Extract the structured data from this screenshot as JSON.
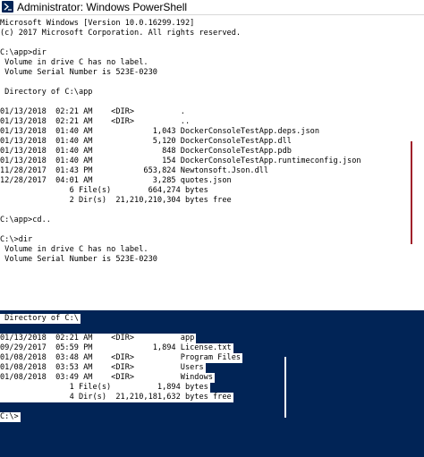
{
  "window": {
    "title": "Administrator: Windows PowerShell",
    "icon": "powershell-icon"
  },
  "console": {
    "upper_lines": [
      "Microsoft Windows [Version 10.0.16299.192]",
      "(c) 2017 Microsoft Corporation. All rights reserved.",
      "",
      "C:\\app>dir",
      " Volume in drive C has no label.",
      " Volume Serial Number is 523E-0230",
      "",
      " Directory of C:\\app",
      "",
      "01/13/2018  02:21 AM    <DIR>          .",
      "01/13/2018  02:21 AM    <DIR>          ..",
      "01/13/2018  01:40 AM             1,043 DockerConsoleTestApp.deps.json",
      "01/13/2018  01:40 AM             5,120 DockerConsoleTestApp.dll",
      "01/13/2018  01:40 AM               848 DockerConsoleTestApp.pdb",
      "01/13/2018  01:40 AM               154 DockerConsoleTestApp.runtimeconfig.json",
      "11/28/2017  01:43 PM           653,824 Newtonsoft.Json.dll",
      "12/28/2017  04:01 AM             3,285 quotes.json",
      "               6 File(s)        664,274 bytes",
      "               2 Dir(s)  21,210,210,304 bytes free",
      "",
      "C:\\app>cd..",
      "",
      "C:\\>dir",
      " Volume in drive C has no label.",
      " Volume Serial Number is 523E-0230",
      ""
    ],
    "lower_lines": [
      " Directory of C:\\",
      "",
      "01/13/2018  02:21 AM    <DIR>          app",
      "09/29/2017  05:59 PM             1,894 License.txt",
      "01/08/2018  03:48 AM    <DIR>          Program Files",
      "01/08/2018  03:53 AM    <DIR>          Users",
      "01/08/2018  03:49 AM    <DIR>          Windows",
      "               1 File(s)          1,894 bytes",
      "               4 Dir(s)  21,210,181,632 bytes free",
      "",
      "C:\\>"
    ],
    "colors": {
      "upper_background": "#ffffff",
      "lower_background": "#012456",
      "text": "#000000",
      "highlight": "#ffffff",
      "scroll_marker": "#a0202a"
    }
  }
}
